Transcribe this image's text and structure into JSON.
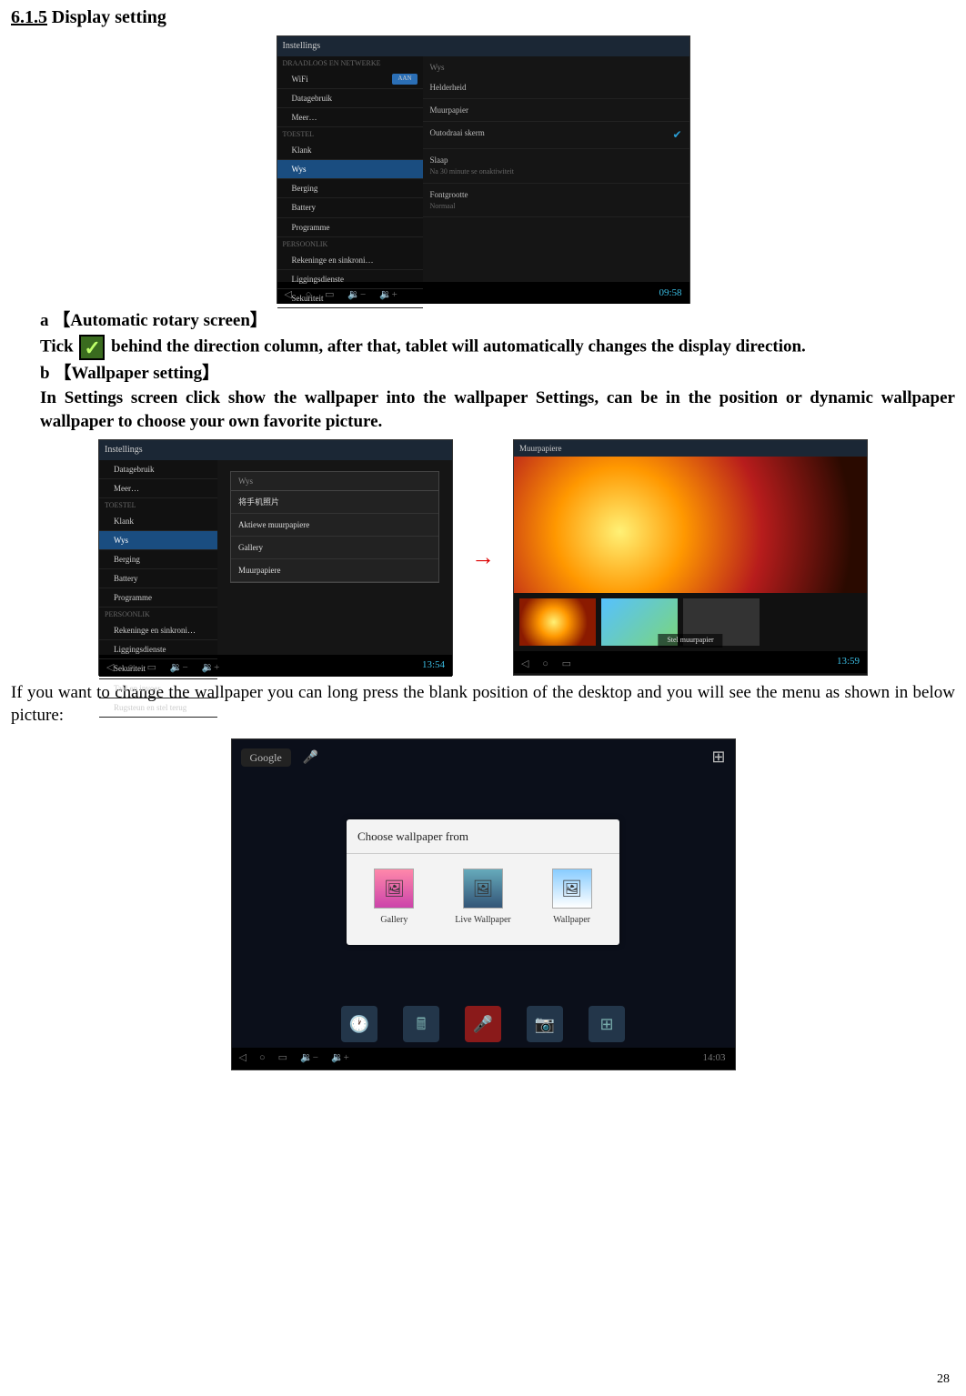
{
  "heading": {
    "num": "6.1.5",
    "title": "Display setting"
  },
  "screenshot1": {
    "app_title": "Instellings",
    "cat1": "DRAADLOOS EN NETWERKE",
    "wifi": "WiFi",
    "wifi_toggle": "AAN",
    "data": "Datagebruik",
    "more": "Meer…",
    "cat2": "TOESTEL",
    "sound": "Klank",
    "display": "Wys",
    "storage": "Berging",
    "battery": "Battery",
    "apps": "Programme",
    "cat3": "PERSOONLIK",
    "accounts": "Rekeninge en sinkroni…",
    "location": "Liggingsdienste",
    "security": "Sekuriteit",
    "main_head": "Wys",
    "row1": "Helderheid",
    "row2": "Muurpapier",
    "row3": "Outodraai skerm",
    "row4": "Slaap",
    "row4sub": "Na 30 minute se onaktiwiteit",
    "row5": "Fontgrootte",
    "row5sub": "Normaal",
    "clock": "09:58"
  },
  "a_label": "a ",
  "a_title": "【Automatic rotary screen】",
  "tick_pre": "Tick ",
  "tick_post": " behind the direction column, after that, tablet will automatically changes the display direction.",
  "b_label": "b ",
  "b_title": "【Wallpaper setting】",
  "b_text": "In Settings screen click show the wallpaper into the wallpaper Settings, can be in the position or dynamic wallpaper wallpaper to choose your own favorite picture.",
  "screenshot2": {
    "app_title": "Instellings",
    "data": "Datagebruik",
    "more": "Meer…",
    "cat2": "TOESTEL",
    "sound": "Klank",
    "display": "Wys",
    "storage": "Berging",
    "battery": "Battery",
    "apps": "Programme",
    "cat3": "PERSOONLIK",
    "accounts": "Rekeninge en sinkroni…",
    "location": "Liggingsdienste",
    "security": "Sekuriteit",
    "lang": "Taal en invoer",
    "backup": "Rugsteun en stel terug",
    "popup_head": "Wys",
    "opt0": "将手机照片",
    "opt1": "Aktiewe muurpapiere",
    "opt2": "Gallery",
    "opt3": "Muurpapiere",
    "clock": "13:54"
  },
  "arrow": "→",
  "screenshot3": {
    "app_title": "Muurpapiere",
    "button": "Stel muurpapier",
    "clock": "13:59"
  },
  "para_longpress": "If you want to change the wallpaper you can long press the blank position of the desktop and you will see the menu as shown in below picture:",
  "screenshot4": {
    "search": "Google",
    "dialog_title": "Choose wallpaper from",
    "opt1": "Gallery",
    "opt2": "Live Wallpaper",
    "opt3": "Wallpaper",
    "clock": "14:03"
  },
  "page": "28"
}
